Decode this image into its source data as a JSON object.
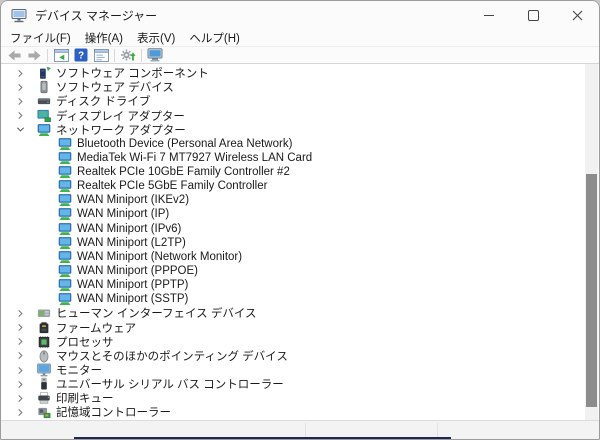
{
  "window": {
    "title": "デバイス マネージャー"
  },
  "titlebar": {
    "app_icon": "device-manager-app-icon",
    "buttons": [
      "minimize-icon",
      "maximize-icon",
      "close-icon"
    ]
  },
  "menu": {
    "items": [
      "ファイル(F)",
      "操作(A)",
      "表示(V)",
      "ヘルプ(H)"
    ]
  },
  "toolbar": {
    "icons": [
      "back-icon",
      "forward-icon",
      "show-console-tree-icon",
      "help-icon",
      "properties-icon",
      "scan-hardware-changes-icon",
      "device-manager-icon"
    ]
  },
  "colors": {
    "help_blue": "#2b5fc2",
    "green_accent": "#2fae43",
    "screen_blue": "#66b5e8",
    "scrollbar_thumb": "#8c8c8c"
  },
  "tree": {
    "items": [
      {
        "label": "ソフトウェア コンポーネント",
        "icon": "software-component-icon",
        "level": 0,
        "expander": "collapsed"
      },
      {
        "label": "ソフトウェア デバイス",
        "icon": "software-device-icon",
        "level": 0,
        "expander": "collapsed"
      },
      {
        "label": "ディスク ドライブ",
        "icon": "disk-drive-icon",
        "level": 0,
        "expander": "collapsed"
      },
      {
        "label": "ディスプレイ アダプター",
        "icon": "display-adapter-icon",
        "level": 0,
        "expander": "collapsed"
      },
      {
        "label": "ネットワーク アダプター",
        "icon": "network-adapter-icon",
        "level": 0,
        "expander": "expanded"
      },
      {
        "label": "Bluetooth Device (Personal Area Network)",
        "icon": "network-adapter-icon",
        "level": 1,
        "expander": "none"
      },
      {
        "label": "MediaTek Wi-Fi 7 MT7927 Wireless LAN Card",
        "icon": "network-adapter-icon",
        "level": 1,
        "expander": "none"
      },
      {
        "label": "Realtek PCIe 10GbE Family Controller #2",
        "icon": "network-adapter-icon",
        "level": 1,
        "expander": "none"
      },
      {
        "label": "Realtek PCIe 5GbE Family Controller",
        "icon": "network-adapter-icon",
        "level": 1,
        "expander": "none"
      },
      {
        "label": "WAN Miniport (IKEv2)",
        "icon": "network-adapter-icon",
        "level": 1,
        "expander": "none"
      },
      {
        "label": "WAN Miniport (IP)",
        "icon": "network-adapter-icon",
        "level": 1,
        "expander": "none"
      },
      {
        "label": "WAN Miniport (IPv6)",
        "icon": "network-adapter-icon",
        "level": 1,
        "expander": "none"
      },
      {
        "label": "WAN Miniport (L2TP)",
        "icon": "network-adapter-icon",
        "level": 1,
        "expander": "none"
      },
      {
        "label": "WAN Miniport (Network Monitor)",
        "icon": "network-adapter-icon",
        "level": 1,
        "expander": "none"
      },
      {
        "label": "WAN Miniport (PPPOE)",
        "icon": "network-adapter-icon",
        "level": 1,
        "expander": "none"
      },
      {
        "label": "WAN Miniport (PPTP)",
        "icon": "network-adapter-icon",
        "level": 1,
        "expander": "none"
      },
      {
        "label": "WAN Miniport (SSTP)",
        "icon": "network-adapter-icon",
        "level": 1,
        "expander": "none"
      },
      {
        "label": "ヒューマン インターフェイス デバイス",
        "icon": "hid-icon",
        "level": 0,
        "expander": "collapsed"
      },
      {
        "label": "ファームウェア",
        "icon": "firmware-icon",
        "level": 0,
        "expander": "collapsed"
      },
      {
        "label": "プロセッサ",
        "icon": "processor-icon",
        "level": 0,
        "expander": "collapsed"
      },
      {
        "label": "マウスとそのほかのポインティング デバイス",
        "icon": "mouse-icon",
        "level": 0,
        "expander": "collapsed"
      },
      {
        "label": "モニター",
        "icon": "monitor-icon",
        "level": 0,
        "expander": "collapsed"
      },
      {
        "label": "ユニバーサル シリアル バス コントローラー",
        "icon": "usb-icon",
        "level": 0,
        "expander": "collapsed"
      },
      {
        "label": "印刷キュー",
        "icon": "print-queue-icon",
        "level": 0,
        "expander": "collapsed"
      },
      {
        "label": "記憶域コントローラー",
        "icon": "storage-controller-icon",
        "level": 0,
        "expander": "collapsed"
      }
    ]
  },
  "statusbar": {
    "text": ""
  }
}
